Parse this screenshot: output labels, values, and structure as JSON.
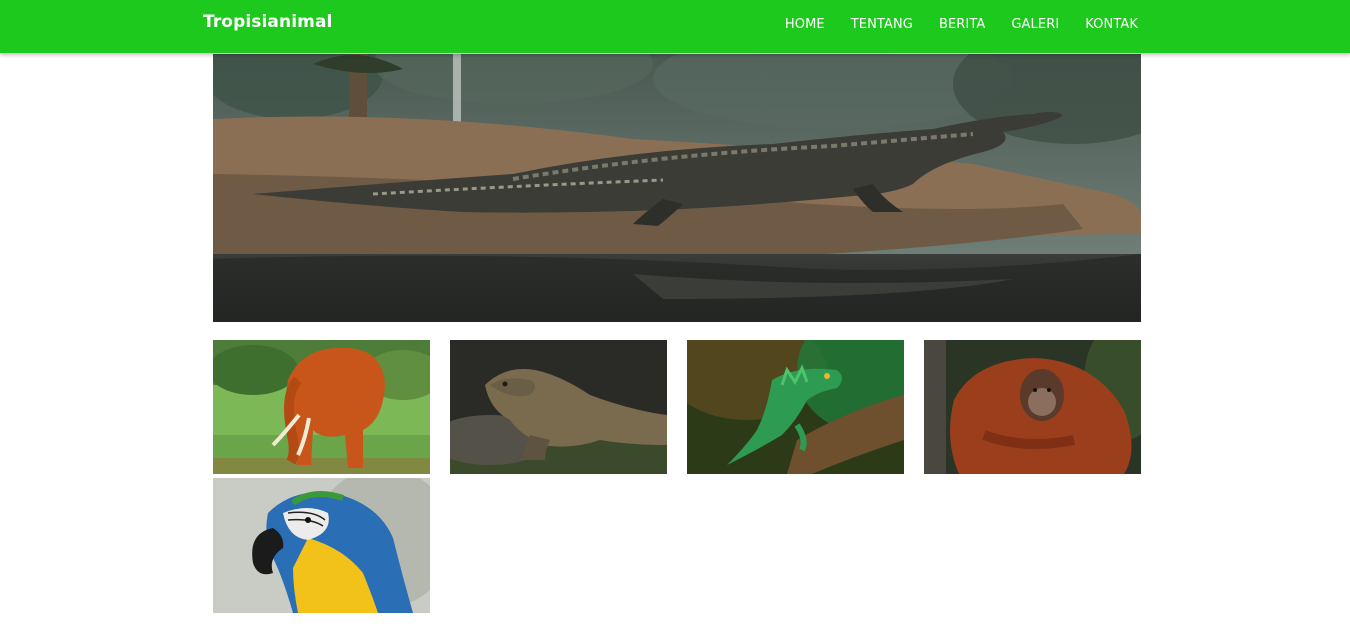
{
  "header": {
    "brand": "Tropisianimal",
    "nav": [
      {
        "label": "HOME"
      },
      {
        "label": "TENTANG"
      },
      {
        "label": "BERITA"
      },
      {
        "label": "GALERI"
      },
      {
        "label": "KONTAK"
      }
    ],
    "accent_color": "#1dc91d"
  },
  "hero": {
    "subject": "crocodile-photo"
  },
  "gallery": {
    "items": [
      {
        "subject": "elephant-photo"
      },
      {
        "subject": "komodo-dragon-photo"
      },
      {
        "subject": "green-lizard-photo"
      },
      {
        "subject": "orangutan-photo"
      },
      {
        "subject": "macaw-parrot-photo"
      }
    ]
  }
}
